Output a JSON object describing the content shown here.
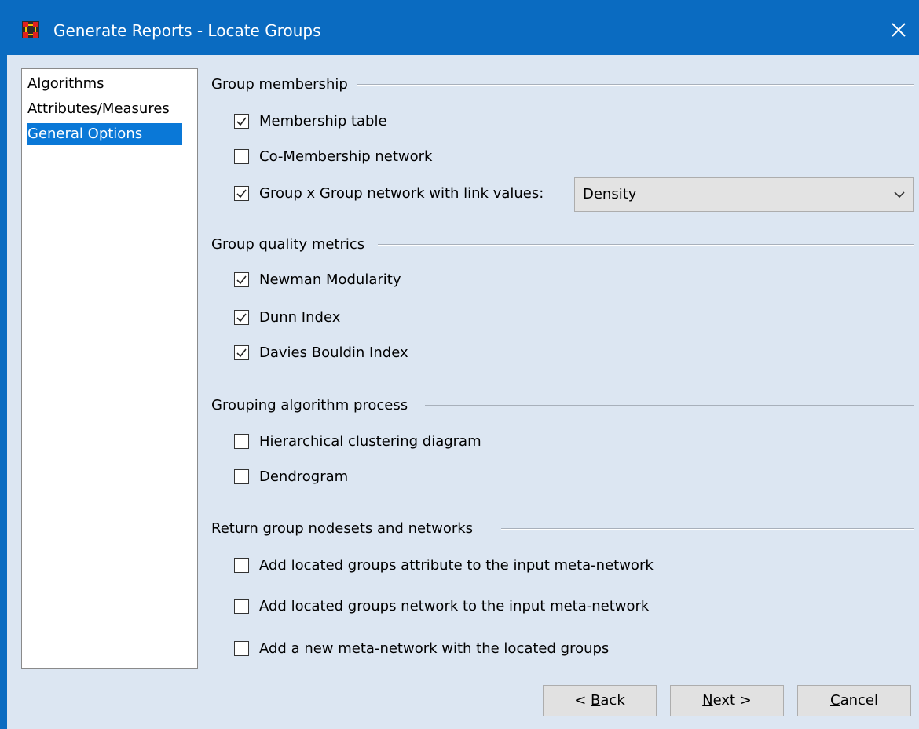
{
  "window": {
    "title": "Generate Reports - Locate Groups",
    "accent_color": "#0a6bc1",
    "icons": {
      "app": "network-grid-icon",
      "close": "close-icon"
    }
  },
  "nav": {
    "items": [
      {
        "label": "Algorithms",
        "selected": false
      },
      {
        "label": "Attributes/Measures",
        "selected": false
      },
      {
        "label": "General Options",
        "selected": true
      }
    ]
  },
  "sections": {
    "group_membership": {
      "title": "Group membership",
      "membership_table": {
        "label": "Membership table",
        "checked": true
      },
      "co_membership": {
        "label": "Co-Membership network",
        "checked": false
      },
      "group_x_group": {
        "label": "Group x Group network with link values:",
        "checked": true
      },
      "link_value_select": {
        "value": "Density"
      }
    },
    "quality": {
      "title": "Group quality metrics",
      "newman": {
        "label": "Newman Modularity",
        "checked": true
      },
      "dunn": {
        "label": "Dunn Index",
        "checked": true
      },
      "davies": {
        "label": "Davies Bouldin Index",
        "checked": true
      }
    },
    "process": {
      "title": "Grouping algorithm process",
      "hierarchical": {
        "label": "Hierarchical clustering diagram",
        "checked": false
      },
      "dendrogram": {
        "label": "Dendrogram",
        "checked": false
      }
    },
    "return_groups": {
      "title": "Return group nodesets and networks",
      "attribute": {
        "label": "Add located groups attribute to the input meta-network",
        "checked": false
      },
      "network": {
        "label": "Add located groups network to the input meta-network",
        "checked": false
      },
      "new_meta": {
        "label": "Add a new meta-network with the located groups",
        "checked": false
      }
    }
  },
  "buttons": {
    "back": {
      "prefix": "< ",
      "mnemonic": "B",
      "rest": "ack"
    },
    "next": {
      "prefix": "",
      "mnemonic": "N",
      "rest": "ext >"
    },
    "cancel": {
      "prefix": "",
      "mnemonic": "C",
      "rest": "ancel"
    }
  }
}
